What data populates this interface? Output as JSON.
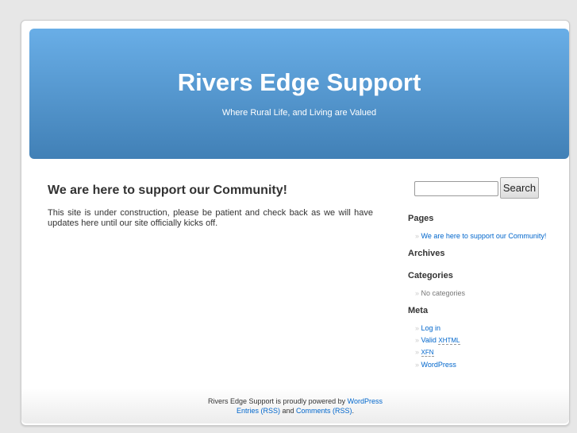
{
  "header": {
    "title": "Rivers Edge Support",
    "description": "Where Rural Life, and Living are Valued"
  },
  "post": {
    "title": "We are here to support our Community!",
    "body": "This site is under construction, please be patient and check back as we will have updates here until our site officially kicks off."
  },
  "sidebar": {
    "search": {
      "value": "",
      "button": "Search"
    },
    "pages": {
      "title": "Pages",
      "items": [
        "We are here to support our Community!"
      ]
    },
    "archives": {
      "title": "Archives"
    },
    "categories": {
      "title": "Categories",
      "items": [
        "No categories"
      ]
    },
    "meta": {
      "title": "Meta",
      "login": "Log in",
      "valid": "Valid",
      "xhtml": "XHTML",
      "xfn": "XFN",
      "wordpress": "WordPress"
    }
  },
  "footer": {
    "text1": "Rivers Edge Support is proudly powered by",
    "wordpress": "WordPress",
    "entries": "Entries (RSS)",
    "and": "and",
    "comments": "Comments (RSS)",
    "end": "."
  }
}
